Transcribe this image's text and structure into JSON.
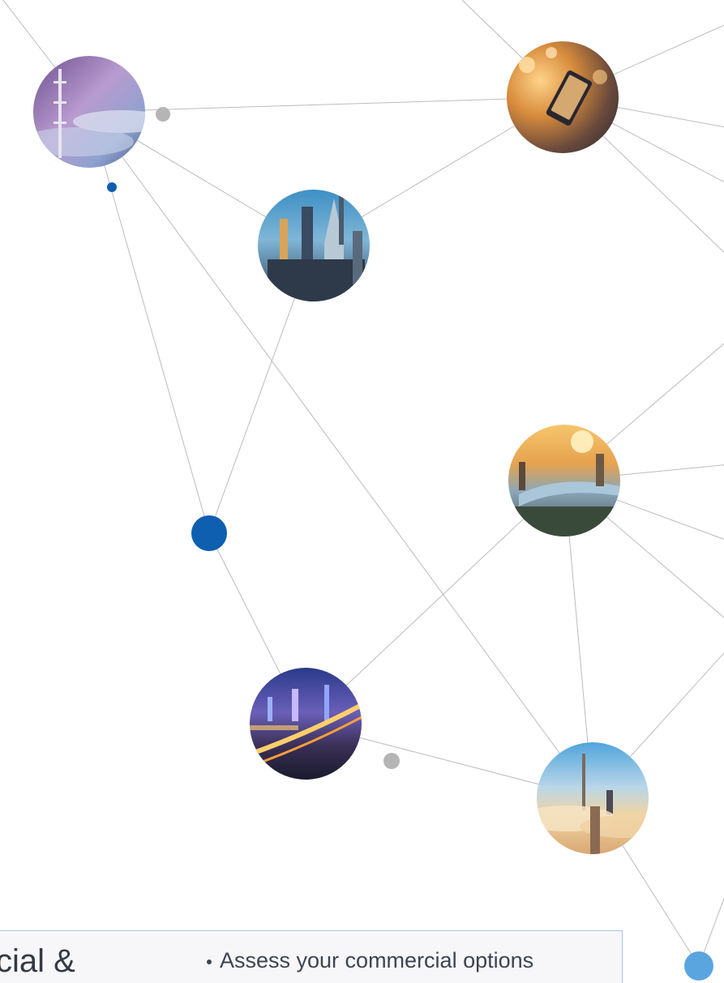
{
  "colors": {
    "line": "#bcbcbc",
    "dot_gray": "#b5b5b5",
    "dot_blue_dark": "#0f5fb0",
    "dot_blue_light": "#5aa5e0",
    "card_border": "#a9c4e8",
    "card_bg": "#f7f7f9"
  },
  "network": {
    "photos": [
      {
        "name": "telecom-tower-photo",
        "subject": "telecom tower at sunset"
      },
      {
        "name": "smartphone-photo",
        "subject": "hand holding smartphone with city lights"
      },
      {
        "name": "skyscrapers-photo",
        "subject": "city skyscrapers at dusk"
      },
      {
        "name": "river-city-photo",
        "subject": "city river at sunrise"
      },
      {
        "name": "night-highway-photo",
        "subject": "illuminated city highway at night"
      },
      {
        "name": "cloud-towers-photo",
        "subject": "towers above the clouds at sunrise"
      }
    ]
  },
  "card": {
    "title": "cial &",
    "bullet": "Assess your commercial options"
  }
}
